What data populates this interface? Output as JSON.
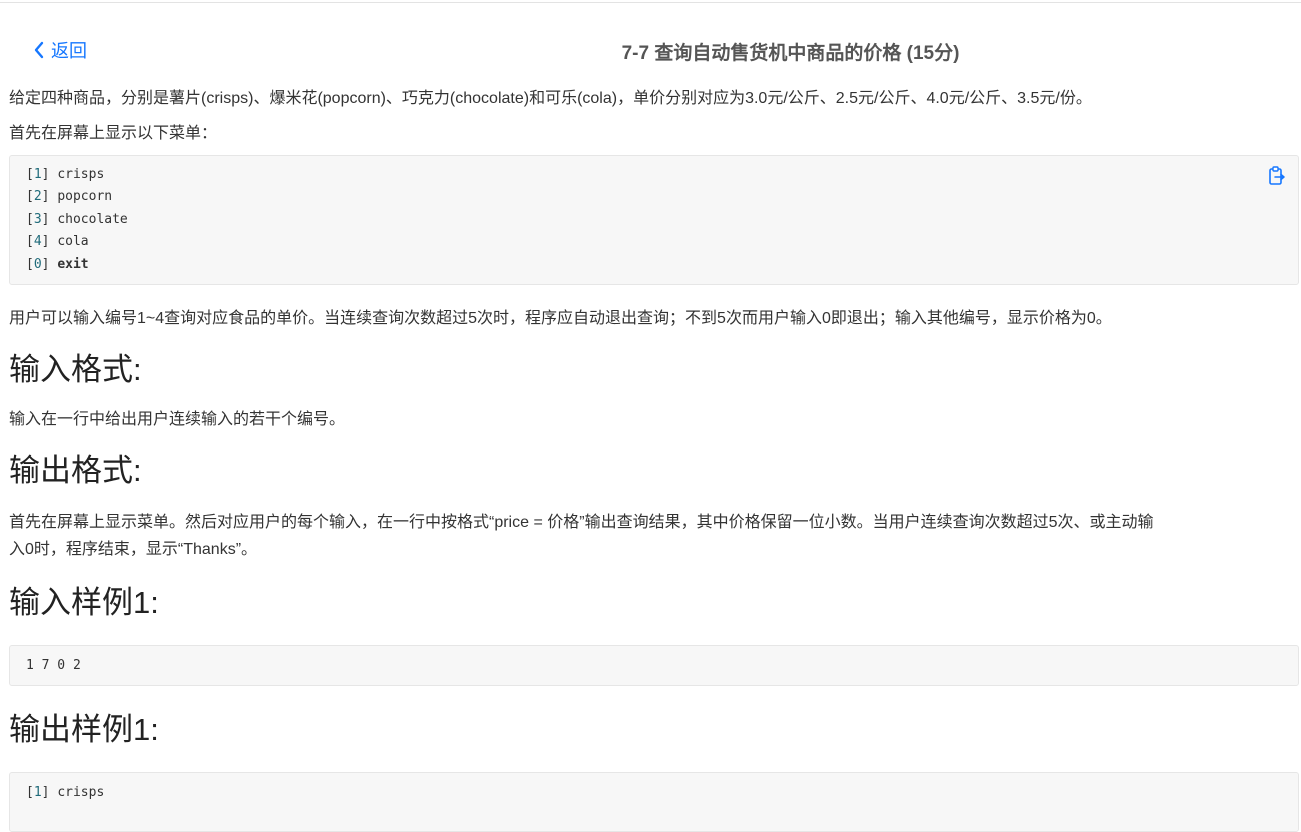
{
  "header": {
    "back_label": "返回",
    "title": "7-7 查询自动售货机中商品的价格 (15分)"
  },
  "description": {
    "para1": "给定四种商品，分别是薯片(crisps)、爆米花(popcorn)、巧克力(chocolate)和可乐(cola)，单价分别对应为3.0元/公斤、2.5元/公斤、4.0元/公斤、3.5元/份。",
    "para2": "首先在屏幕上显示以下菜单：",
    "menu": [
      {
        "num": "1",
        "label": "crisps"
      },
      {
        "num": "2",
        "label": "popcorn"
      },
      {
        "num": "3",
        "label": "chocolate"
      },
      {
        "num": "4",
        "label": "cola"
      },
      {
        "num": "0",
        "label": "exit"
      }
    ],
    "para3": "用户可以输入编号1~4查询对应食品的单价。当连续查询次数超过5次时，程序应自动退出查询；不到5次而用户输入0即退出；输入其他编号，显示价格为0。"
  },
  "input_format": {
    "heading": "输入格式:",
    "text": "输入在一行中给出用户连续输入的若干个编号。"
  },
  "output_format": {
    "heading": "输出格式:",
    "text_line1": "首先在屏幕上显示菜单。然后对应用户的每个输入，在一行中按格式“price = 价格”输出查询结果，其中价格保留一位小数。当用户连续查询次数超过5次、或主动输",
    "text_line2": "入0时，程序结束，显示“Thanks”。"
  },
  "sample_input": {
    "heading": "输入样例1:",
    "code": "1 7 0 2"
  },
  "sample_output": {
    "heading": "输出样例1:",
    "line1_num": "1",
    "line1_label": "crisps"
  },
  "icons": {
    "back": "chevron-left-icon",
    "copy": "clipboard-copy-icon"
  },
  "colors": {
    "link": "#1677ff",
    "code_bg": "#f7f7f7",
    "code_number": "#1f6b7a"
  }
}
